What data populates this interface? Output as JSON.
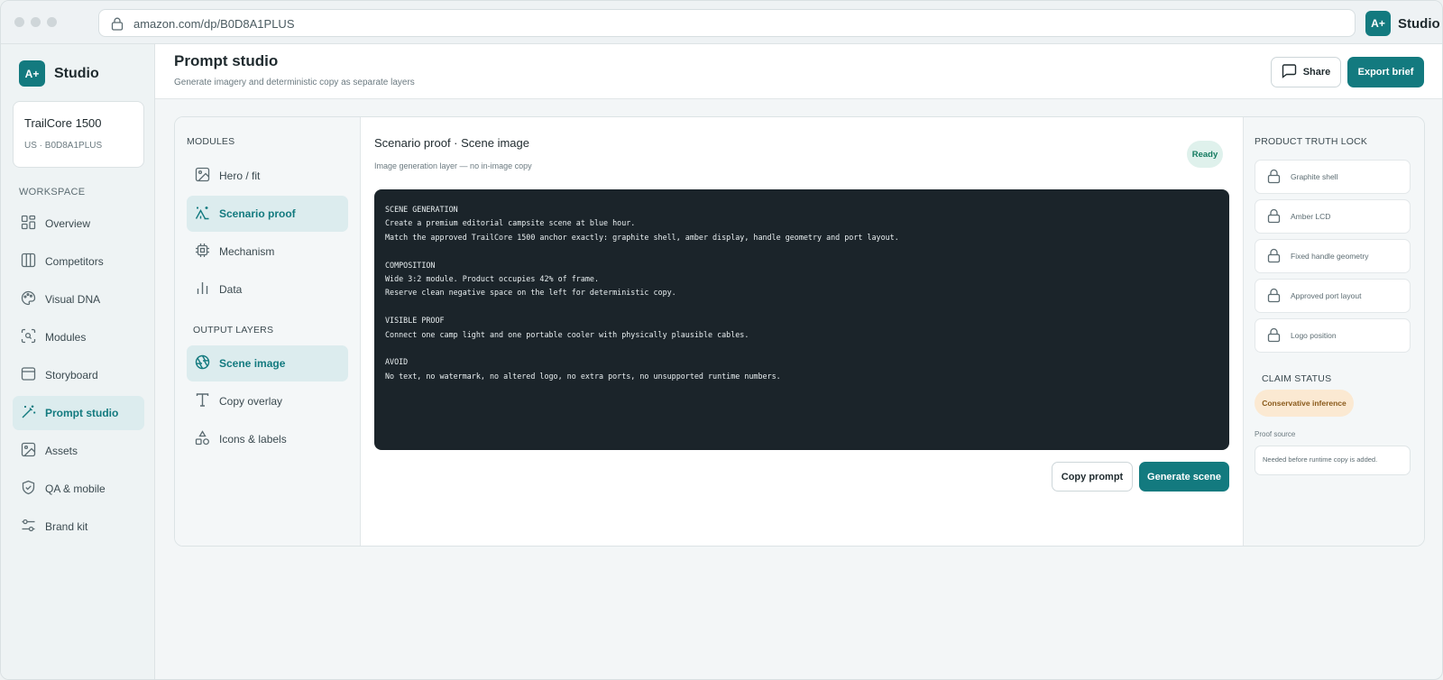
{
  "browser": {
    "url": "amazon.com/dp/B0D8A1PLUS",
    "brand_badge": "A+",
    "brand_name": "Studio"
  },
  "sidebar": {
    "brand_badge": "A+",
    "brand_name": "Studio",
    "product": {
      "name": "TrailCore 1500",
      "sub": "US · B0D8A1PLUS"
    },
    "section_label": "WORKSPACE",
    "items": [
      {
        "label": "Overview",
        "icon": "grid-icon"
      },
      {
        "label": "Competitors",
        "icon": "columns-icon"
      },
      {
        "label": "Visual DNA",
        "icon": "palette-icon"
      },
      {
        "label": "Modules",
        "icon": "scan-search-icon"
      },
      {
        "label": "Storyboard",
        "icon": "storyboard-icon"
      },
      {
        "label": "Prompt studio",
        "icon": "wand-icon",
        "active": true
      },
      {
        "label": "Assets",
        "icon": "image-icon"
      },
      {
        "label": "QA & mobile",
        "icon": "shield-check-icon"
      },
      {
        "label": "Brand kit",
        "icon": "sliders-icon"
      }
    ]
  },
  "header": {
    "title": "Prompt studio",
    "subtitle": "Generate imagery and deterministic copy as separate layers",
    "share_label": "Share",
    "export_label": "Export brief"
  },
  "modules": {
    "label": "MODULES",
    "items": [
      {
        "label": "Hero / fit",
        "icon": "image-icon"
      },
      {
        "label": "Scenario proof",
        "icon": "tent-icon",
        "active": true
      },
      {
        "label": "Mechanism",
        "icon": "chip-icon"
      },
      {
        "label": "Data",
        "icon": "bar-chart-icon"
      }
    ],
    "output_label": "OUTPUT LAYERS",
    "output_items": [
      {
        "label": "Scene image",
        "icon": "aperture-icon",
        "active": true
      },
      {
        "label": "Copy overlay",
        "icon": "type-icon"
      },
      {
        "label": "Icons & labels",
        "icon": "shapes-icon"
      }
    ]
  },
  "editor": {
    "title": "Scenario proof · Scene image",
    "subtitle": "Image generation layer — no in-image copy",
    "status": "Ready",
    "prompt": "SCENE GENERATION\nCreate a premium editorial campsite scene at blue hour.\nMatch the approved TrailCore 1500 anchor exactly: graphite shell, amber display, handle geometry and port layout.\n\nCOMPOSITION\nWide 3:2 module. Product occupies 42% of frame.\nReserve clean negative space on the left for deterministic copy.\n\nVISIBLE PROOF\nConnect one camp light and one portable cooler with physically plausible cables.\n\nAVOID\nNo text, no watermark, no altered logo, no extra ports, no unsupported runtime numbers.",
    "copy_label": "Copy prompt",
    "generate_label": "Generate scene"
  },
  "truth_lock": {
    "label": "PRODUCT TRUTH LOCK",
    "items": [
      {
        "label": "Graphite shell"
      },
      {
        "label": "Amber LCD"
      },
      {
        "label": "Fixed handle geometry"
      },
      {
        "label": "Approved port layout"
      },
      {
        "label": "Logo position"
      }
    ],
    "claim_label": "CLAIM STATUS",
    "claim_value": "Conservative inference",
    "proof_label": "Proof source",
    "proof_value": "Needed before runtime copy is added."
  },
  "colors": {
    "accent": "#137a7f",
    "ready_bg": "#dff1ec",
    "claim_bg": "#fbe9d2",
    "code_bg": "#1b242a"
  }
}
